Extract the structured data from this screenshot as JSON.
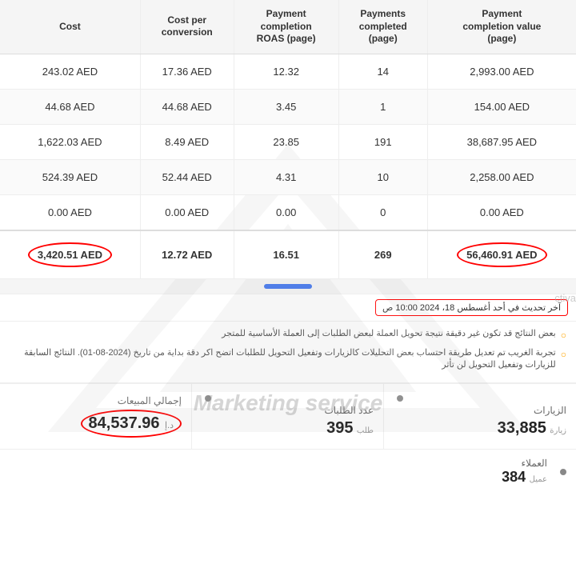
{
  "table": {
    "headers": [
      "Cost",
      "Cost per\nconversion",
      "Payment\ncompletion\nROAS (page)",
      "Payments\ncompleted\n(page)",
      "Payment\ncompletion value\n(page)"
    ],
    "rows": [
      [
        "243.02 AED",
        "17.36 AED",
        "12.32",
        "14",
        "2,993.00 AED"
      ],
      [
        "44.68 AED",
        "44.68 AED",
        "3.45",
        "1",
        "154.00 AED"
      ],
      [
        "1,622.03 AED",
        "8.49 AED",
        "23.85",
        "191",
        "38,687.95 AED"
      ],
      [
        "524.39 AED",
        "52.44 AED",
        "4.31",
        "10",
        "2,258.00 AED"
      ],
      [
        "0.00 AED",
        "0.00 AED",
        "0.00",
        "0",
        "0.00 AED"
      ]
    ],
    "total_row": [
      "3,420.51 AED",
      "12.72 AED",
      "16.51",
      "269",
      "56,460.91 AED"
    ]
  },
  "date_update": "آخر تحديث في أحد أغسطس 18، 2024 10:00 ص",
  "notices": [
    "بعض النتائج قد تكون غير دقيقة نتيجة تحويل العملة لبعض الطلبات إلى العملة الأساسية للمتجر",
    "تجربة الغريب تم تعديل طريقة احتساب بعض التحليلات كالزيارات وتفعيل التحويل للطلبات اتضح اكر دقة بداية من تاريخ (2024-08-01). النتائج السابقة للزيارات وتفعيل التحويل لن تأثر"
  ],
  "stats": {
    "total_sales_label": "إجمالي المبيعات",
    "total_sales_value": "84,537.96",
    "total_sales_currency": "د.إ",
    "orders_label": "عدد الطلبات",
    "orders_value": "395",
    "orders_unit": "طلب",
    "visits_label": "الزيارات",
    "visits_value": "33,885",
    "visits_unit": "زيارة"
  },
  "customers": {
    "label": "العملاء",
    "value": "384",
    "unit": "عميل"
  },
  "activa_partial": "ctiva"
}
